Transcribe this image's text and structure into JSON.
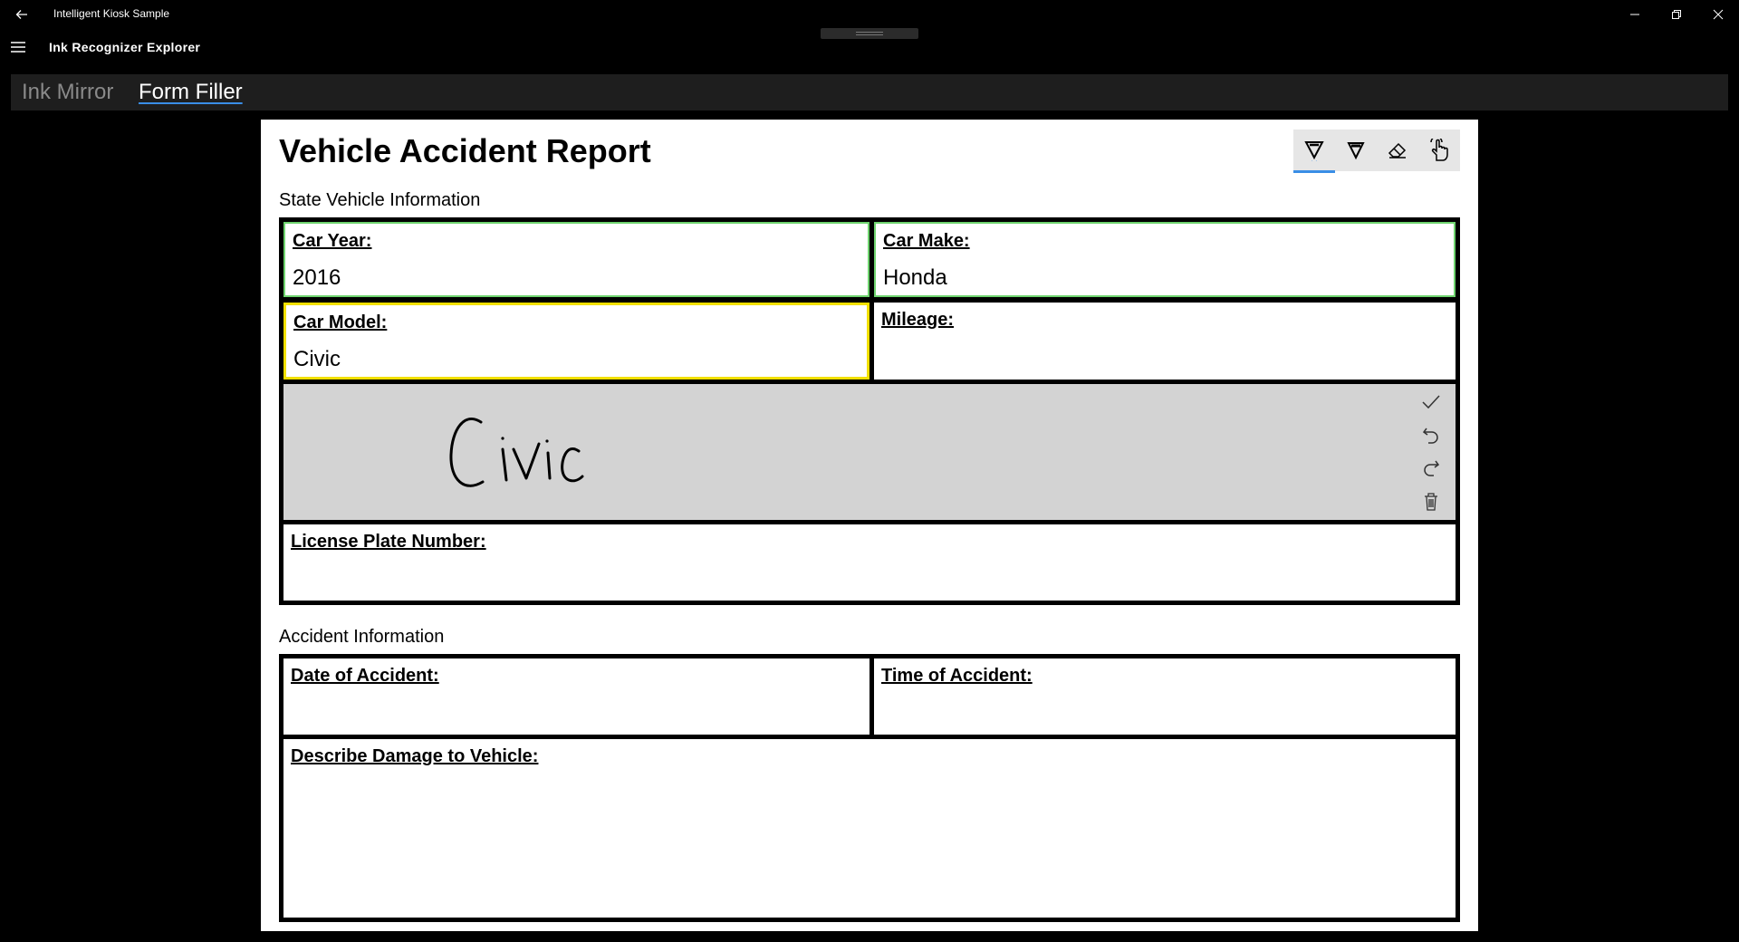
{
  "window": {
    "title": "Intelligent Kiosk Sample"
  },
  "header": {
    "page_title": "Ink Recognizer Explorer"
  },
  "pivot": {
    "tabs": [
      {
        "label": "Ink Mirror",
        "selected": false
      },
      {
        "label": "Form Filler",
        "selected": true
      }
    ]
  },
  "form": {
    "title": "Vehicle Accident Report",
    "toolbar": {
      "tools": [
        "ballpoint-pen-icon",
        "pencil-icon",
        "eraser-icon",
        "touch-writing-icon"
      ],
      "selected_tool": "ballpoint-pen-icon",
      "accent": "#3a8ee6"
    },
    "sections": {
      "vehicle": {
        "title": "State Vehicle Information",
        "fields": {
          "car_year": {
            "label": "Car Year:",
            "value": "2016",
            "status": "recognized",
            "color": "#6fd46f"
          },
          "car_make": {
            "label": "Car Make:",
            "value": "Honda",
            "status": "recognized",
            "color": "#6fd46f"
          },
          "car_model": {
            "label": "Car Model:",
            "value": "Civic",
            "status": "active",
            "color": "#f2e000"
          },
          "mileage": {
            "label": "Mileage:",
            "value": ""
          },
          "license_plate": {
            "label": "License Plate Number:",
            "value": ""
          }
        },
        "ink_panel": {
          "handwriting": "Civic",
          "actions": [
            "accept-check-icon",
            "undo-icon",
            "redo-icon",
            "delete-trash-icon"
          ],
          "background": "#d3d3d3"
        }
      },
      "accident": {
        "title": "Accident Information",
        "fields": {
          "date": {
            "label": "Date of Accident:",
            "value": ""
          },
          "time": {
            "label": "Time of Accident:",
            "value": ""
          },
          "damage": {
            "label": "Describe Damage to Vehicle:",
            "value": ""
          }
        }
      }
    }
  }
}
